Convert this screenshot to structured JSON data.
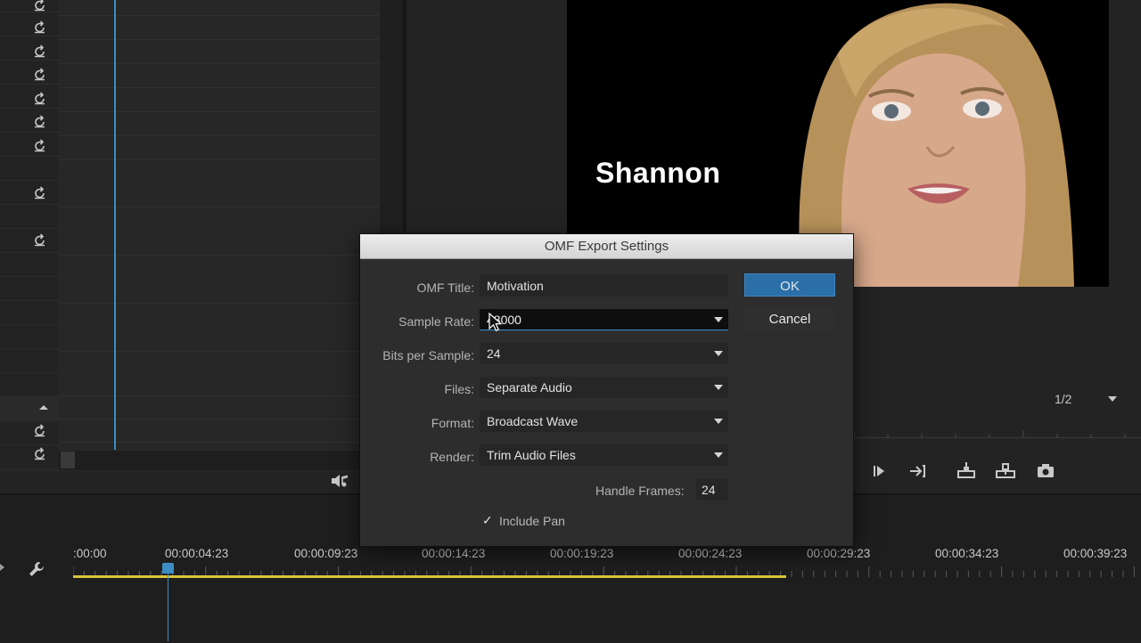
{
  "dialog": {
    "title": "OMF Export Settings",
    "fields": {
      "omf_title": {
        "label": "OMF Title:",
        "value": "Motivation"
      },
      "sample_rate": {
        "label": "Sample Rate:",
        "value": "48000"
      },
      "bits_per_sample": {
        "label": "Bits per Sample:",
        "value": "24"
      },
      "files": {
        "label": "Files:",
        "value": "Separate Audio"
      },
      "format": {
        "label": "Format:",
        "value": "Broadcast Wave"
      },
      "render": {
        "label": "Render:",
        "value": "Trim Audio Files"
      }
    },
    "handle_frames": {
      "label": "Handle Frames:",
      "value": "24"
    },
    "include_pan": {
      "label": "Include Pan",
      "check_glyph": "✓",
      "checked": true
    },
    "ok_label": "OK",
    "cancel_label": "Cancel"
  },
  "monitor": {
    "video_title": "Shannon",
    "zoom": "1/2"
  },
  "timeline": {
    "timecodes": [
      ":00:00",
      "00:00:04:23",
      "00:00:09:23",
      "00:00:14:23",
      "00:00:19:23",
      "00:00:24:23",
      "00:00:29:23",
      "00:00:34:23",
      "00:00:39:23"
    ]
  },
  "colors": {
    "accent_blue": "#2a6fa8",
    "playhead": "#3c8dc4",
    "work_area": "#d8c43a"
  },
  "icons": [
    "reset-icon",
    "mixer-icon",
    "wrench-icon",
    "play-in-to-out-icon",
    "go-to-out-icon",
    "lift-icon",
    "extract-icon",
    "camera-icon",
    "dropdown-arrow-icon",
    "mouse-cursor-icon",
    "checkmark-icon"
  ]
}
